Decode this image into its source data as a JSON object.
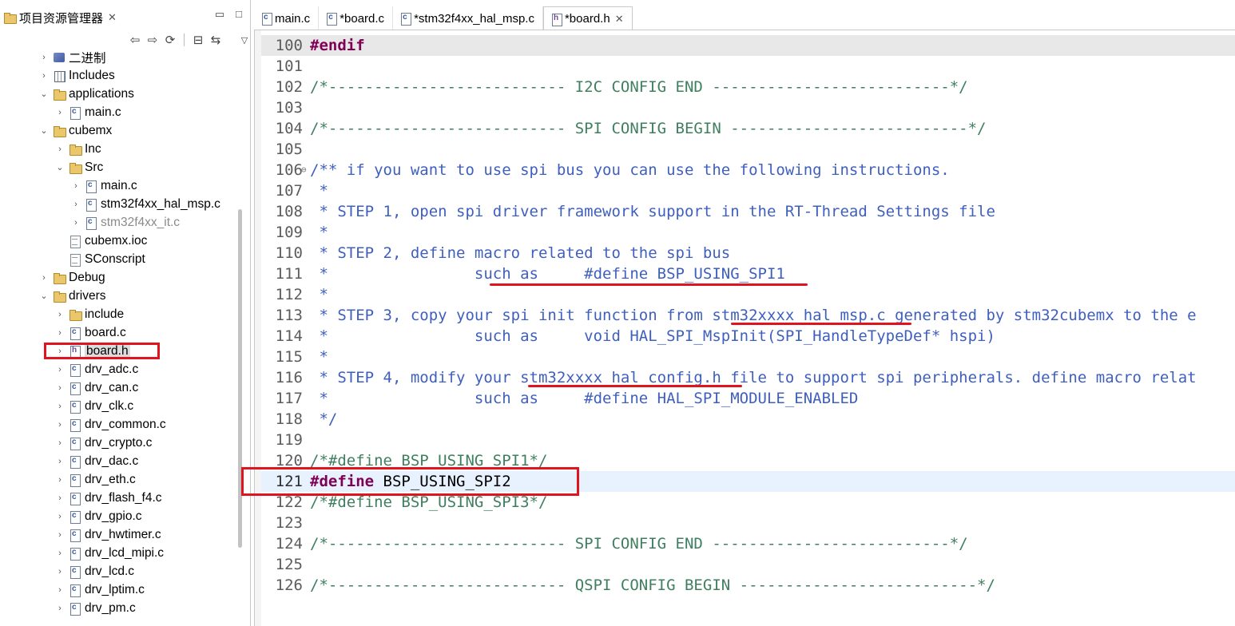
{
  "explorer": {
    "title": "项目资源管理器",
    "tree": [
      {
        "label": "二进制",
        "icon": "binary-icon",
        "indent": 0,
        "arrow": "›",
        "kind": "binary"
      },
      {
        "label": "Includes",
        "icon": "includes-icon",
        "indent": 0,
        "arrow": "›",
        "kind": "includes"
      },
      {
        "label": "applications",
        "icon": "folder-icon",
        "indent": 0,
        "arrow": "⌄",
        "kind": "folder"
      },
      {
        "label": "main.c",
        "icon": "c-file-icon",
        "indent": 1,
        "arrow": "›",
        "kind": "cfile"
      },
      {
        "label": "cubemx",
        "icon": "folder-icon",
        "indent": 0,
        "arrow": "⌄",
        "kind": "folder"
      },
      {
        "label": "Inc",
        "icon": "folder-icon",
        "indent": 1,
        "arrow": "›",
        "kind": "folder"
      },
      {
        "label": "Src",
        "icon": "folder-icon",
        "indent": 1,
        "arrow": "⌄",
        "kind": "folder"
      },
      {
        "label": "main.c",
        "icon": "c-file-icon",
        "indent": 2,
        "arrow": "›",
        "kind": "cfile"
      },
      {
        "label": "stm32f4xx_hal_msp.c",
        "icon": "c-file-icon",
        "indent": 2,
        "arrow": "›",
        "kind": "cfile"
      },
      {
        "label": "stm32f4xx_it.c",
        "icon": "c-file-icon",
        "indent": 2,
        "arrow": "›",
        "kind": "cfile",
        "gray": true
      },
      {
        "label": "cubemx.ioc",
        "icon": "doc-icon",
        "indent": 1,
        "arrow": "",
        "kind": "doc"
      },
      {
        "label": "SConscript",
        "icon": "doc-icon",
        "indent": 1,
        "arrow": "",
        "kind": "doc"
      },
      {
        "label": "Debug",
        "icon": "folder-icon",
        "indent": 0,
        "arrow": "›",
        "kind": "folder"
      },
      {
        "label": "drivers",
        "icon": "folder-icon",
        "indent": 0,
        "arrow": "⌄",
        "kind": "folder"
      },
      {
        "label": "include",
        "icon": "folder-icon",
        "indent": 1,
        "arrow": "›",
        "kind": "folder"
      },
      {
        "label": "board.c",
        "icon": "c-file-icon",
        "indent": 1,
        "arrow": "›",
        "kind": "cfile"
      },
      {
        "label": "board.h",
        "icon": "h-file-icon",
        "indent": 1,
        "arrow": "›",
        "kind": "hfile",
        "selected": true
      },
      {
        "label": "drv_adc.c",
        "icon": "c-file-icon",
        "indent": 1,
        "arrow": "›",
        "kind": "cfile"
      },
      {
        "label": "drv_can.c",
        "icon": "c-file-icon",
        "indent": 1,
        "arrow": "›",
        "kind": "cfile"
      },
      {
        "label": "drv_clk.c",
        "icon": "c-file-icon",
        "indent": 1,
        "arrow": "›",
        "kind": "cfile"
      },
      {
        "label": "drv_common.c",
        "icon": "c-file-icon",
        "indent": 1,
        "arrow": "›",
        "kind": "cfile"
      },
      {
        "label": "drv_crypto.c",
        "icon": "c-file-icon",
        "indent": 1,
        "arrow": "›",
        "kind": "cfile"
      },
      {
        "label": "drv_dac.c",
        "icon": "c-file-icon",
        "indent": 1,
        "arrow": "›",
        "kind": "cfile"
      },
      {
        "label": "drv_eth.c",
        "icon": "c-file-icon",
        "indent": 1,
        "arrow": "›",
        "kind": "cfile"
      },
      {
        "label": "drv_flash_f4.c",
        "icon": "c-file-icon",
        "indent": 1,
        "arrow": "›",
        "kind": "cfile"
      },
      {
        "label": "drv_gpio.c",
        "icon": "c-file-icon",
        "indent": 1,
        "arrow": "›",
        "kind": "cfile"
      },
      {
        "label": "drv_hwtimer.c",
        "icon": "c-file-icon",
        "indent": 1,
        "arrow": "›",
        "kind": "cfile"
      },
      {
        "label": "drv_lcd_mipi.c",
        "icon": "c-file-icon",
        "indent": 1,
        "arrow": "›",
        "kind": "cfile"
      },
      {
        "label": "drv_lcd.c",
        "icon": "c-file-icon",
        "indent": 1,
        "arrow": "›",
        "kind": "cfile"
      },
      {
        "label": "drv_lptim.c",
        "icon": "c-file-icon",
        "indent": 1,
        "arrow": "›",
        "kind": "cfile"
      },
      {
        "label": "drv_pm.c",
        "icon": "c-file-icon",
        "indent": 1,
        "arrow": "›",
        "kind": "cfile"
      }
    ]
  },
  "editor": {
    "tabs": [
      {
        "label": "main.c",
        "icon": "c-file-icon",
        "active": false
      },
      {
        "label": "*board.c",
        "icon": "c-file-icon",
        "active": false
      },
      {
        "label": "*stm32f4xx_hal_msp.c",
        "icon": "c-file-icon",
        "active": false
      },
      {
        "label": "*board.h",
        "icon": "h-file-icon",
        "active": true
      }
    ],
    "lines": [
      {
        "num": "100",
        "segments": [
          {
            "t": "#endif",
            "c": "kw"
          }
        ]
      },
      {
        "num": "101",
        "segments": []
      },
      {
        "num": "102",
        "segments": [
          {
            "t": "/*-------------------------- I2C CONFIG END --------------------------*/",
            "c": "cmt"
          }
        ]
      },
      {
        "num": "103",
        "segments": []
      },
      {
        "num": "104",
        "segments": [
          {
            "t": "/*-------------------------- SPI CONFIG BEGIN --------------------------*/",
            "c": "cmt"
          }
        ]
      },
      {
        "num": "105",
        "segments": []
      },
      {
        "num": "106",
        "fold": true,
        "segments": [
          {
            "t": "/** if you want to use spi bus you can use the following instructions.",
            "c": "doccmt"
          }
        ]
      },
      {
        "num": "107",
        "segments": [
          {
            "t": " *",
            "c": "doccmt"
          }
        ]
      },
      {
        "num": "108",
        "segments": [
          {
            "t": " * STEP 1, open spi driver framework support in the RT-Thread Settings file",
            "c": "doccmt"
          }
        ]
      },
      {
        "num": "109",
        "segments": [
          {
            "t": " *",
            "c": "doccmt"
          }
        ]
      },
      {
        "num": "110",
        "segments": [
          {
            "t": " * STEP 2, define macro related to the spi bus",
            "c": "doccmt"
          }
        ]
      },
      {
        "num": "111",
        "segments": [
          {
            "t": " *                such as     #define BSP_USING_SPI1",
            "c": "doccmt"
          }
        ]
      },
      {
        "num": "112",
        "segments": [
          {
            "t": " *",
            "c": "doccmt"
          }
        ]
      },
      {
        "num": "113",
        "segments": [
          {
            "t": " * STEP 3, copy your spi init function from stm32xxxx_hal_msp.c generated by stm32cubemx to the e",
            "c": "doccmt"
          }
        ]
      },
      {
        "num": "114",
        "segments": [
          {
            "t": " *                such as     void HAL_SPI_MspInit(SPI_HandleTypeDef* hspi)",
            "c": "doccmt"
          }
        ]
      },
      {
        "num": "115",
        "segments": [
          {
            "t": " *",
            "c": "doccmt"
          }
        ]
      },
      {
        "num": "116",
        "segments": [
          {
            "t": " * STEP 4, modify your stm32xxxx_hal_config.h file to support spi peripherals. define macro relat",
            "c": "doccmt"
          }
        ]
      },
      {
        "num": "117",
        "segments": [
          {
            "t": " *                such as     #define HAL_SPI_MODULE_ENABLED",
            "c": "doccmt"
          }
        ]
      },
      {
        "num": "118",
        "segments": [
          {
            "t": " */",
            "c": "doccmt"
          }
        ]
      },
      {
        "num": "119",
        "segments": []
      },
      {
        "num": "120",
        "segments": [
          {
            "t": "/*#define BSP_USING_SPI1*/",
            "c": "cmt"
          }
        ]
      },
      {
        "num": "121",
        "current": true,
        "segments": [
          {
            "t": "#define",
            "c": "kw"
          },
          {
            "t": " BSP_USING_SPI2",
            "c": "plain"
          }
        ]
      },
      {
        "num": "122",
        "segments": [
          {
            "t": "/*#define BSP_USING_SPI3*/",
            "c": "cmt"
          }
        ]
      },
      {
        "num": "123",
        "segments": []
      },
      {
        "num": "124",
        "segments": [
          {
            "t": "/*-------------------------- SPI CONFIG END --------------------------*/",
            "c": "cmt"
          }
        ]
      },
      {
        "num": "125",
        "segments": []
      },
      {
        "num": "126",
        "segments": [
          {
            "t": "/*-------------------------- QSPI CONFIG BEGIN --------------------------*/",
            "c": "cmt"
          }
        ]
      }
    ]
  }
}
